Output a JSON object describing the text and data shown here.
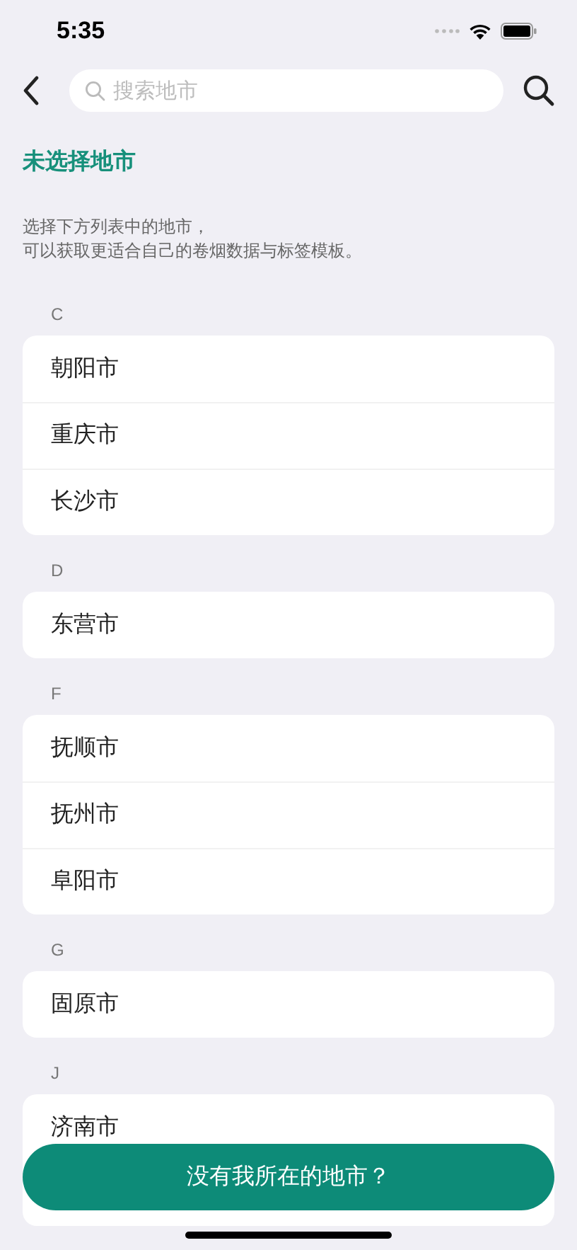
{
  "status_bar": {
    "time": "5:35"
  },
  "search": {
    "placeholder": "搜索地市"
  },
  "title": "未选择地市",
  "description": [
    "选择下方列表中的地市，",
    "可以获取更适合自己的卷烟数据与标签模板。"
  ],
  "sections": [
    {
      "letter": "C",
      "cities": [
        "朝阳市",
        "重庆市",
        "长沙市"
      ]
    },
    {
      "letter": "D",
      "cities": [
        "东营市"
      ]
    },
    {
      "letter": "F",
      "cities": [
        "抚顺市",
        "抚州市",
        "阜阳市"
      ]
    },
    {
      "letter": "G",
      "cities": [
        "固原市"
      ]
    },
    {
      "letter": "J",
      "cities": [
        "济南市"
      ]
    }
  ],
  "bottom_button": "没有我所在的地市？"
}
